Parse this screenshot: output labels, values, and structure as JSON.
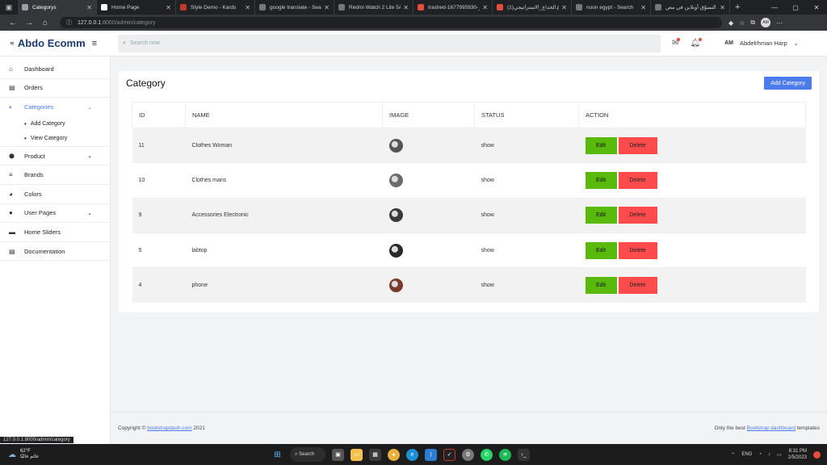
{
  "browser": {
    "tabs": [
      {
        "title": "Categorys",
        "active": true,
        "color": "#9aa0a6"
      },
      {
        "title": "Home Page",
        "active": false,
        "color": "#ffffff"
      },
      {
        "title": "Style Demo - Kards",
        "active": false,
        "color": "#c0392b"
      },
      {
        "title": "google translate - Sea",
        "active": false,
        "color": "#777777"
      },
      {
        "title": "Redmi Watch 2 Lite 5A",
        "active": false,
        "color": "#777777"
      },
      {
        "title": "trashed-1677995930-_",
        "active": false,
        "color": "#e74c3c"
      },
      {
        "title": "الخداع_الاستراتيجي(1).pdf",
        "active": false,
        "color": "#e74c3c"
      },
      {
        "title": "noon egypt - Search",
        "active": false,
        "color": "#777777"
      },
      {
        "title": "التسوّق أونلاين في مص",
        "active": false,
        "color": "#777777"
      }
    ],
    "url_host": "127.0.0.1",
    "url_rest": ":8000/admin/category"
  },
  "app": {
    "brand": "Abdo Ecomm",
    "search_placeholder": "Search now",
    "user_initials": "AM",
    "user_name": "Abdelrhman Harp"
  },
  "sidebar": {
    "items": [
      {
        "label": "Dashboard",
        "icon": "home-icon",
        "glyph": "⌂"
      },
      {
        "label": "Orders",
        "icon": "orders-icon",
        "glyph": "▤"
      },
      {
        "label": "Categories",
        "icon": "categories-icon",
        "glyph": "◐"
      },
      {
        "label": "Product",
        "icon": "product-icon",
        "glyph": "⬢"
      },
      {
        "label": "Brands",
        "icon": "brands-icon",
        "glyph": "≡"
      },
      {
        "label": "Colors",
        "icon": "palette-icon",
        "glyph": "◕"
      },
      {
        "label": "User Pages",
        "icon": "user-icon",
        "glyph": "●"
      },
      {
        "label": "Home Sliders",
        "icon": "slider-icon",
        "glyph": "▬"
      },
      {
        "label": "Documentation",
        "icon": "doc-icon",
        "glyph": "▤"
      }
    ],
    "sub_add": "Add Category",
    "sub_view": "View Category"
  },
  "page": {
    "title": "Category",
    "add_button": "Add Category",
    "columns": [
      "ID",
      "NAME",
      "IMAGE",
      "STATUS",
      "ACTION"
    ],
    "rows": [
      {
        "id": "11",
        "name": "Clothes Woman",
        "status": "show",
        "thumb": "#555555"
      },
      {
        "id": "10",
        "name": "Clothes mans",
        "status": "show",
        "thumb": "#6b6b6b"
      },
      {
        "id": "9",
        "name": "Accessories Electronic",
        "status": "show",
        "thumb": "#3a3a3a"
      },
      {
        "id": "5",
        "name": "labtop",
        "status": "show",
        "thumb": "#2a2a2a"
      },
      {
        "id": "4",
        "name": "phone",
        "status": "show",
        "thumb": "#7a3a2a"
      }
    ],
    "edit_label": "Edit",
    "delete_label": "Delete"
  },
  "footer": {
    "copy_prefix": "Copyright ©",
    "copy_link": "bootstrapdash.com",
    "copy_year": "2021",
    "right_prefix": "Only the best",
    "right_link": "Bootstrap dashboard",
    "right_suffix": "templates"
  },
  "status_url": "127.0.0.1:8000/admin/category",
  "taskbar": {
    "temp": "62°F",
    "weather_text": "غائم غالبًا",
    "search": "Search",
    "lang": "ENG",
    "time": "8:31 PM",
    "date": "2/5/2023"
  },
  "colors": {
    "accent": "#4b7bec",
    "edit": "#5aba0c",
    "delete": "#ff4b4b",
    "brand": "#1e3a6e"
  }
}
